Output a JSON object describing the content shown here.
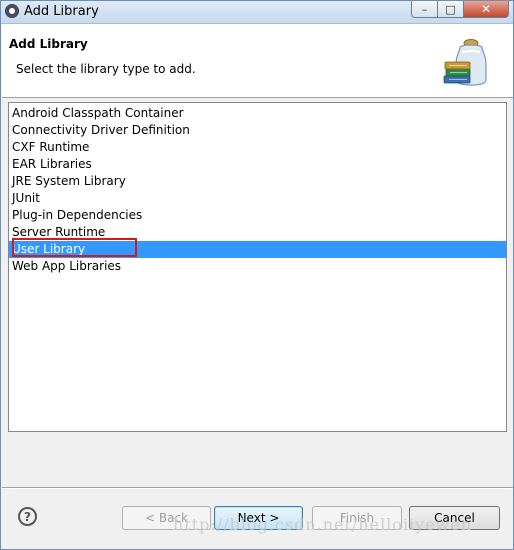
{
  "window": {
    "title": "Add Library",
    "controls": {
      "minimize": "–",
      "maximize": "□",
      "close": "✕"
    }
  },
  "header": {
    "title": "Add Library",
    "description": "Select the library type to add.",
    "icon": "library-jar-icon"
  },
  "library_types": [
    "Android Classpath Container",
    "Connectivity Driver Definition",
    "CXF Runtime",
    "EAR Libraries",
    "JRE System Library",
    "JUnit",
    "Plug-in Dependencies",
    "Server Runtime",
    "User Library",
    "Web App Libraries"
  ],
  "selected_index": 8,
  "colors": {
    "selection": "#3399ff",
    "annotation": "#d41b1b"
  },
  "buttons": {
    "help": "?",
    "back": "< Back",
    "next": "Next >",
    "finish": "Finish",
    "cancel": "Cancel"
  },
  "watermark": "http://blog.csdn.net/helloiiyewen"
}
